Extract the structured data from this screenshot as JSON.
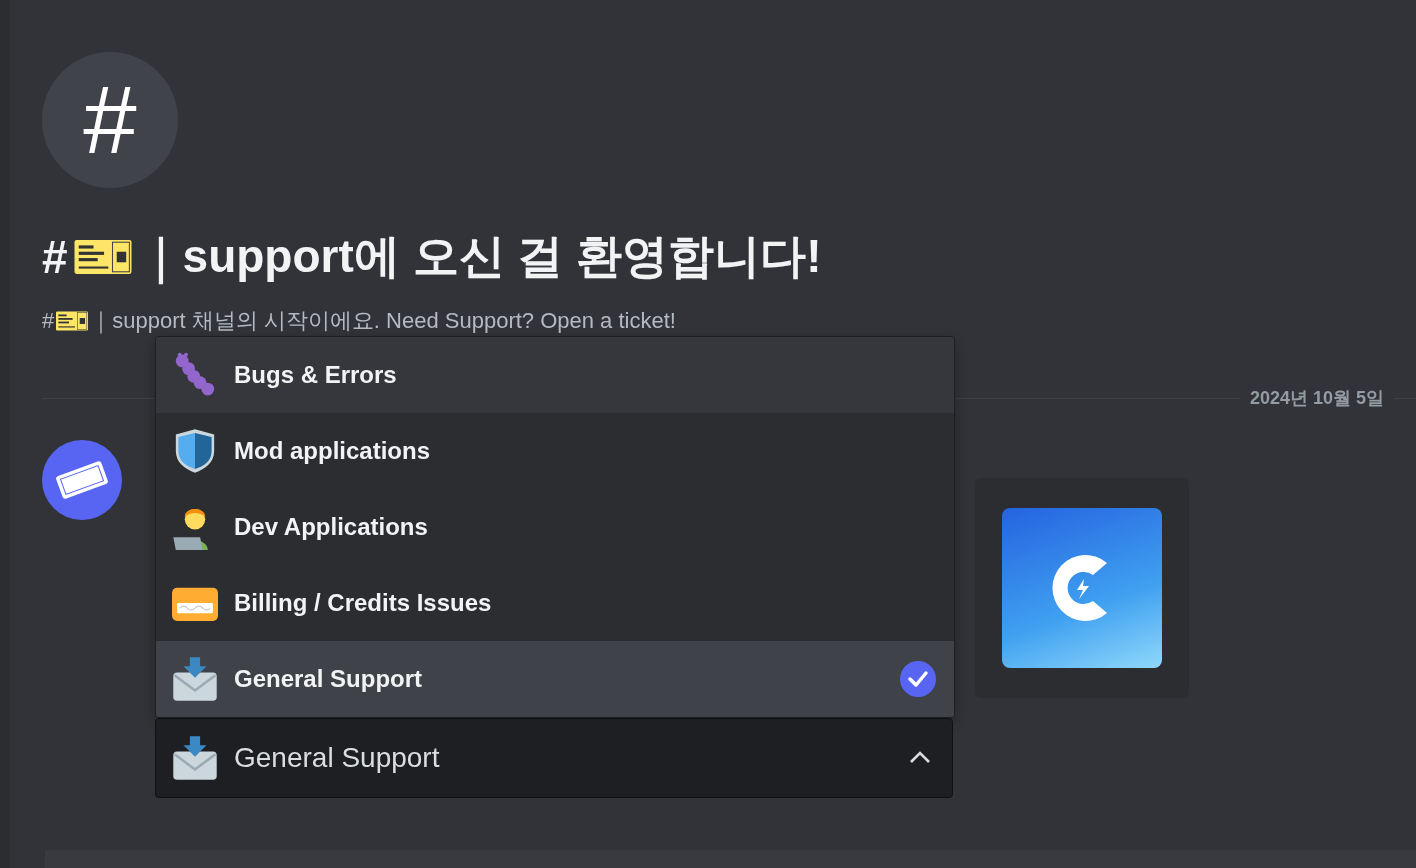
{
  "channel": {
    "hash_icon": "#",
    "title_prefix": "#",
    "title": "｜support에 오신 걸 환영합니다!",
    "subtitle_prefix": "#",
    "subtitle": "｜support 채널의 시작이에요. Need Support? Open a ticket!"
  },
  "date_divider": "2024년 10월 5일",
  "dropdown": {
    "options": [
      {
        "kind": "bug",
        "label": "Bugs & Errors",
        "hovered": true,
        "selected": false
      },
      {
        "kind": "shield",
        "label": "Mod applications",
        "hovered": false,
        "selected": false
      },
      {
        "kind": "developer",
        "label": "Dev Applications",
        "hovered": false,
        "selected": false
      },
      {
        "kind": "card",
        "label": "Billing / Credits Issues",
        "hovered": false,
        "selected": false
      },
      {
        "kind": "envelope",
        "label": "General Support",
        "hovered": false,
        "selected": true
      }
    ],
    "value": {
      "kind": "envelope",
      "label": "General Support"
    },
    "expanded": true
  }
}
